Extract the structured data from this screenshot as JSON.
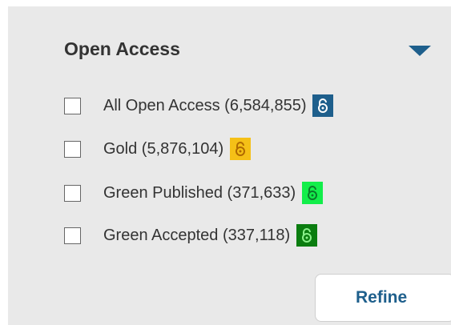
{
  "filter_panel": {
    "title": "Open Access",
    "accent_color": "#1e5f8c",
    "items": [
      {
        "label": "All Open Access (6,584,855)",
        "checked": false,
        "badge_color": "#1e5f8c",
        "badge_icon_color": "#ffffff",
        "icon": "open-lock-icon"
      },
      {
        "label": "Gold (5,876,104)",
        "checked": false,
        "badge_color": "#f5c017",
        "badge_icon_color": "#b06a00",
        "icon": "open-lock-icon"
      },
      {
        "label": "Green Published (371,633)",
        "checked": false,
        "badge_color": "#12ee4a",
        "badge_icon_color": "#0a7a2a",
        "icon": "open-lock-icon"
      },
      {
        "label": "Green Accepted (337,118)",
        "checked": false,
        "badge_color": "#0b7d10",
        "badge_icon_color": "#8af08a",
        "icon": "open-lock-icon"
      }
    ],
    "refine_label": "Refine"
  }
}
